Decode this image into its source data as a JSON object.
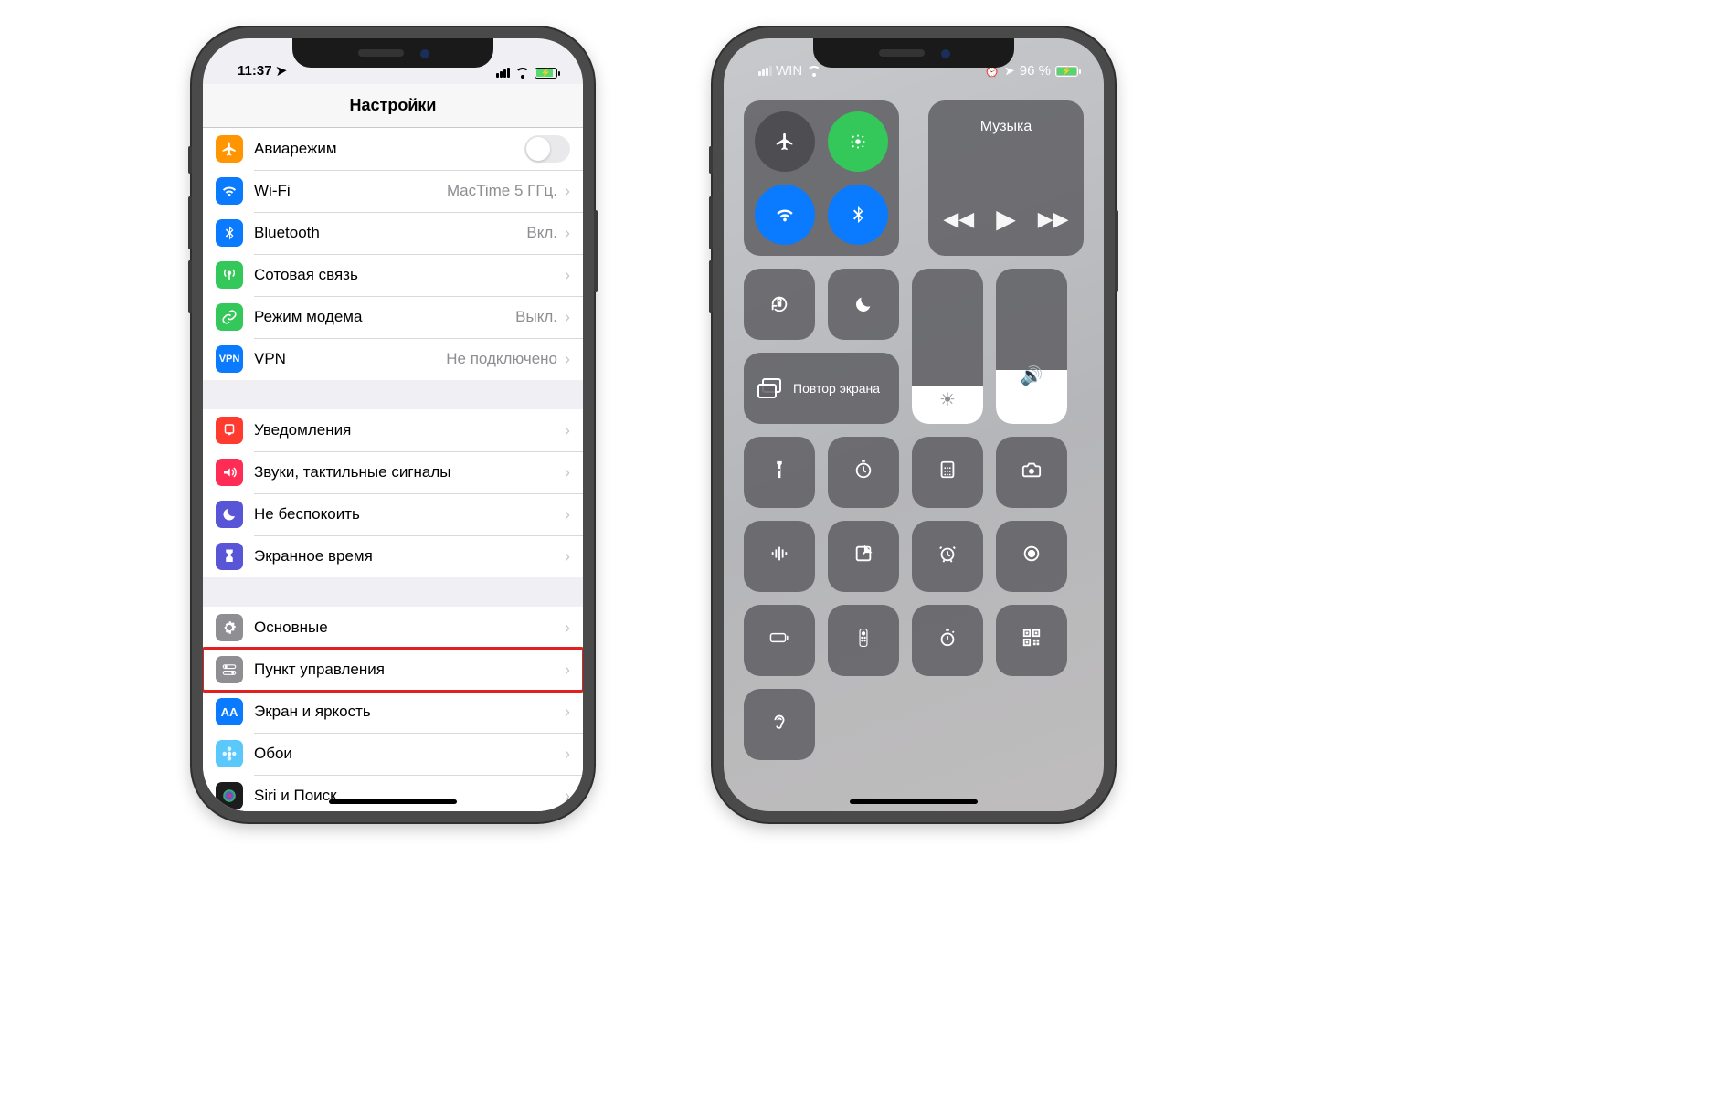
{
  "phone_left": {
    "status": {
      "time": "11:37",
      "location_on": true
    },
    "title": "Настройки",
    "groups": [
      {
        "rows": [
          {
            "id": "airplane",
            "label": "Авиарежим",
            "icon": "airplane",
            "icon_bg": "#ff9500",
            "type": "toggle",
            "value": false
          },
          {
            "id": "wifi",
            "label": "Wi-Fi",
            "icon": "wifi",
            "icon_bg": "#0a7aff",
            "type": "link",
            "detail": "MacTime 5 ГГц."
          },
          {
            "id": "bluetooth",
            "label": "Bluetooth",
            "icon": "bluetooth",
            "icon_bg": "#0a7aff",
            "type": "link",
            "detail": "Вкл."
          },
          {
            "id": "cellular",
            "label": "Сотовая связь",
            "icon": "antenna",
            "icon_bg": "#34c759",
            "type": "link",
            "detail": ""
          },
          {
            "id": "hotspot",
            "label": "Режим модема",
            "icon": "link",
            "icon_bg": "#34c759",
            "type": "link",
            "detail": "Выкл."
          },
          {
            "id": "vpn",
            "label": "VPN",
            "icon": "vpn",
            "icon_bg": "#0a7aff",
            "type": "link",
            "detail": "Не подключено"
          }
        ]
      },
      {
        "rows": [
          {
            "id": "notifications",
            "label": "Уведомления",
            "icon": "bell",
            "icon_bg": "#ff3b30",
            "type": "link"
          },
          {
            "id": "sounds",
            "label": "Звуки, тактильные сигналы",
            "icon": "volume",
            "icon_bg": "#ff2d55",
            "type": "link"
          },
          {
            "id": "dnd",
            "label": "Не беспокоить",
            "icon": "moon",
            "icon_bg": "#5856d6",
            "type": "link"
          },
          {
            "id": "screentime",
            "label": "Экранное время",
            "icon": "hourglass",
            "icon_bg": "#5856d6",
            "type": "link"
          }
        ]
      },
      {
        "rows": [
          {
            "id": "general",
            "label": "Основные",
            "icon": "gear",
            "icon_bg": "#8e8e93",
            "type": "link"
          },
          {
            "id": "controlcenter",
            "label": "Пункт управления",
            "icon": "switches",
            "icon_bg": "#8e8e93",
            "type": "link",
            "highlight": true
          },
          {
            "id": "display",
            "label": "Экран и яркость",
            "icon": "text",
            "icon_bg": "#0a7aff",
            "type": "link"
          },
          {
            "id": "wallpaper",
            "label": "Обои",
            "icon": "flower",
            "icon_bg": "#5ac8fa",
            "type": "link"
          },
          {
            "id": "siri",
            "label": "Siri и Поиск",
            "icon": "siri",
            "icon_bg": "#1c1c1e",
            "type": "link"
          }
        ]
      }
    ]
  },
  "phone_right": {
    "status": {
      "carrier": "WIN",
      "battery_pct": "96 %",
      "alarm_on": true
    },
    "music_label": "Музыка",
    "mirror_label": "Повтор экрана",
    "brightness_pct": 25,
    "volume_pct": 35,
    "connectivity": {
      "airplane": {
        "on": false
      },
      "cellular": {
        "on": true
      },
      "wifi": {
        "on": true
      },
      "bluetooth": {
        "on": true
      }
    },
    "tiles_row1": [
      "flashlight",
      "timer",
      "calculator",
      "camera"
    ],
    "tiles_row2": [
      "voice",
      "note",
      "alarm",
      "record"
    ],
    "tiles_row3": [
      "battery",
      "remote",
      "stopwatch",
      "qr"
    ],
    "tiles_row4": [
      "hearing"
    ]
  }
}
